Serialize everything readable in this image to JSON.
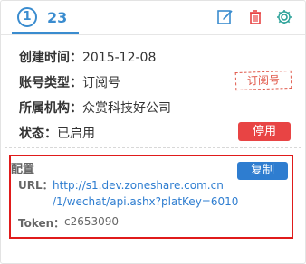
{
  "header": {
    "index": "1",
    "count": "23",
    "icons": [
      "edit-icon",
      "trash-icon",
      "gear-icon"
    ]
  },
  "fields": [
    {
      "label": "创建时间：",
      "value": "2015-12-08"
    },
    {
      "label": "账号类型：",
      "value": "订阅号"
    },
    {
      "label": "所属机构：",
      "value": "众赏科技好公司"
    },
    {
      "label": "状态：",
      "value": "已启用"
    }
  ],
  "stamp": "订阅号",
  "disable_button": "停用",
  "config": {
    "title": "配置",
    "copy_button": "复制",
    "url_label": "URL：",
    "url_line1": "http://s1.dev.zoneshare.com.cn",
    "url_line2": "/1/wechat/api.ashx?platKey=6010",
    "token_label": "Token：",
    "token_value": "c2653090"
  },
  "colors": {
    "accent": "#3a8ccf",
    "danger": "#e84444",
    "link": "#2e7dd0",
    "highlight_border": "#e01b1b"
  }
}
